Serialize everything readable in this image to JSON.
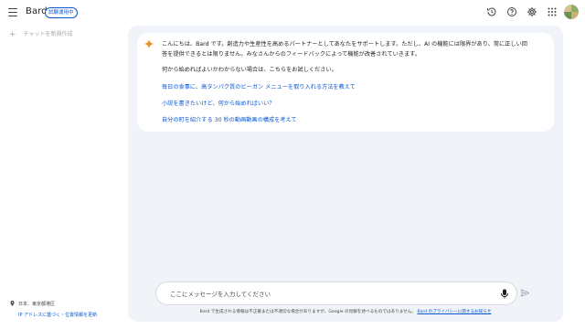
{
  "header": {
    "app_name": "Bard",
    "badge": "試験運用中",
    "icons": [
      "menu-icon",
      "history-icon",
      "help-icon",
      "settings-icon",
      "apps-grid-icon",
      "avatar"
    ]
  },
  "sidebar": {
    "new_chat_label": "チャットを新規作成",
    "location_text": "日本、東京都港区",
    "location_link": "IP アドレスに基づく・位置情報を更新"
  },
  "conversation": {
    "intro": "こんにちは、Bard です。創造力や生産性を高めるパートナーとしてあなたをサポートします。ただし、AI の機能には限界があり、常に正しい回答を提供できるとは限りません。みなさんからのフィードバックによって機能が改善されていきます。",
    "prompt": "何から始めればよいかわからない場合は、こちらをお試しください。",
    "suggestions": [
      "毎日の食事に、高タンパク質のビーガン メニューを取り入れる方法を教えて",
      "小説を書きたいけど、何から始めればいい？",
      "自分の町を紹介する 30 秒の動画動画の構成を考えて"
    ]
  },
  "input": {
    "placeholder": "ここにメッセージを入力してください"
  },
  "footer": {
    "disclaimer": "Bard で生成される情報は不正確または不適切な場合がありますが、Google の見解を述べるものではありません。",
    "privacy_link": "Bard のプライバシーに関するお知らせ"
  },
  "colors": {
    "accent": "#0b57d0",
    "main_bg": "#f0f4f9",
    "card_bg": "#ffffff",
    "text": "#1f1f1f"
  }
}
